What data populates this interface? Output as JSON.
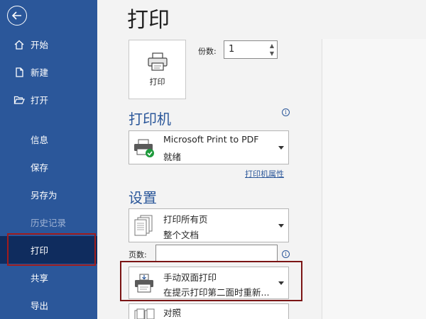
{
  "sidebar": {
    "back_icon": "back-arrow-icon",
    "items": [
      {
        "label": "开始",
        "icon": "home-icon"
      },
      {
        "label": "新建",
        "icon": "new-document-icon"
      },
      {
        "label": "打开",
        "icon": "open-folder-icon"
      },
      {
        "label": "信息"
      },
      {
        "label": "保存"
      },
      {
        "label": "另存为"
      },
      {
        "label": "历史记录",
        "disabled": true
      },
      {
        "label": "打印",
        "selected": true
      },
      {
        "label": "共享"
      },
      {
        "label": "导出"
      }
    ]
  },
  "main": {
    "title": "打印",
    "print_button_label": "打印",
    "copies_label": "份数:",
    "copies_value": "1",
    "printer_section_title": "打印机",
    "printer": {
      "name": "Microsoft Print to PDF",
      "status": "就绪"
    },
    "printer_properties_link": "打印机属性",
    "settings_section_title": "设置",
    "range_setting": {
      "line1": "打印所有页",
      "line2": "整个文档"
    },
    "pages_label": "页数:",
    "pages_value": "",
    "duplex_setting": {
      "line1": "手动双面打印",
      "line2": "在提示打印第二面时重新..."
    },
    "collate_setting": {
      "line1": "对照"
    }
  },
  "colors": {
    "sidebar_bg": "#2b579a",
    "sidebar_selected": "#0f2c5e",
    "highlight_outline": "#a01c1c",
    "accent": "#2b579a"
  }
}
